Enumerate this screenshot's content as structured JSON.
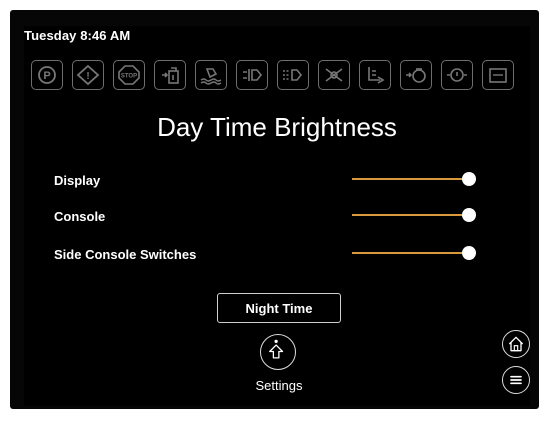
{
  "status": {
    "datetime": "Tuesday 8:46 AM"
  },
  "indicators": [
    {
      "icon": "parking-brake-icon",
      "text": "P"
    },
    {
      "icon": "warning-icon",
      "text": "!"
    },
    {
      "icon": "stop-icon",
      "text": "STOP"
    },
    {
      "icon": "fuel-filter-icon"
    },
    {
      "icon": "water-in-fuel-icon"
    },
    {
      "icon": "transmission-icon"
    },
    {
      "icon": "hydraulic-icon"
    },
    {
      "icon": "fan-icon"
    },
    {
      "icon": "engine-coolant-icon"
    },
    {
      "icon": "oil-pressure-icon"
    },
    {
      "icon": "engine-oil-icon"
    },
    {
      "icon": "battery-icon"
    }
  ],
  "page": {
    "title": "Day Time Brightness"
  },
  "brightness": [
    {
      "label": "Display",
      "level": 1.0
    },
    {
      "label": "Console",
      "level": 1.0
    },
    {
      "label": "Side Console Switches",
      "level": 1.0
    }
  ],
  "buttons": {
    "night_time": "Night Time",
    "settings": "Settings"
  },
  "colors": {
    "slider_accent": "#d89a3c",
    "background": "#000000"
  }
}
